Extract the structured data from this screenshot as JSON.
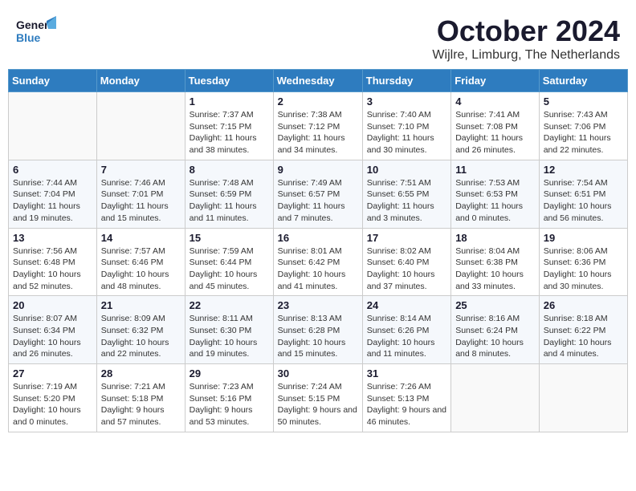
{
  "header": {
    "logo_general": "General",
    "logo_blue": "Blue",
    "title": "October 2024",
    "subtitle": "Wijlre, Limburg, The Netherlands"
  },
  "days_of_week": [
    "Sunday",
    "Monday",
    "Tuesday",
    "Wednesday",
    "Thursday",
    "Friday",
    "Saturday"
  ],
  "weeks": [
    [
      {
        "day": "",
        "info": ""
      },
      {
        "day": "",
        "info": ""
      },
      {
        "day": "1",
        "info": "Sunrise: 7:37 AM\nSunset: 7:15 PM\nDaylight: 11 hours and 38 minutes."
      },
      {
        "day": "2",
        "info": "Sunrise: 7:38 AM\nSunset: 7:12 PM\nDaylight: 11 hours and 34 minutes."
      },
      {
        "day": "3",
        "info": "Sunrise: 7:40 AM\nSunset: 7:10 PM\nDaylight: 11 hours and 30 minutes."
      },
      {
        "day": "4",
        "info": "Sunrise: 7:41 AM\nSunset: 7:08 PM\nDaylight: 11 hours and 26 minutes."
      },
      {
        "day": "5",
        "info": "Sunrise: 7:43 AM\nSunset: 7:06 PM\nDaylight: 11 hours and 22 minutes."
      }
    ],
    [
      {
        "day": "6",
        "info": "Sunrise: 7:44 AM\nSunset: 7:04 PM\nDaylight: 11 hours and 19 minutes."
      },
      {
        "day": "7",
        "info": "Sunrise: 7:46 AM\nSunset: 7:01 PM\nDaylight: 11 hours and 15 minutes."
      },
      {
        "day": "8",
        "info": "Sunrise: 7:48 AM\nSunset: 6:59 PM\nDaylight: 11 hours and 11 minutes."
      },
      {
        "day": "9",
        "info": "Sunrise: 7:49 AM\nSunset: 6:57 PM\nDaylight: 11 hours and 7 minutes."
      },
      {
        "day": "10",
        "info": "Sunrise: 7:51 AM\nSunset: 6:55 PM\nDaylight: 11 hours and 3 minutes."
      },
      {
        "day": "11",
        "info": "Sunrise: 7:53 AM\nSunset: 6:53 PM\nDaylight: 11 hours and 0 minutes."
      },
      {
        "day": "12",
        "info": "Sunrise: 7:54 AM\nSunset: 6:51 PM\nDaylight: 10 hours and 56 minutes."
      }
    ],
    [
      {
        "day": "13",
        "info": "Sunrise: 7:56 AM\nSunset: 6:48 PM\nDaylight: 10 hours and 52 minutes."
      },
      {
        "day": "14",
        "info": "Sunrise: 7:57 AM\nSunset: 6:46 PM\nDaylight: 10 hours and 48 minutes."
      },
      {
        "day": "15",
        "info": "Sunrise: 7:59 AM\nSunset: 6:44 PM\nDaylight: 10 hours and 45 minutes."
      },
      {
        "day": "16",
        "info": "Sunrise: 8:01 AM\nSunset: 6:42 PM\nDaylight: 10 hours and 41 minutes."
      },
      {
        "day": "17",
        "info": "Sunrise: 8:02 AM\nSunset: 6:40 PM\nDaylight: 10 hours and 37 minutes."
      },
      {
        "day": "18",
        "info": "Sunrise: 8:04 AM\nSunset: 6:38 PM\nDaylight: 10 hours and 33 minutes."
      },
      {
        "day": "19",
        "info": "Sunrise: 8:06 AM\nSunset: 6:36 PM\nDaylight: 10 hours and 30 minutes."
      }
    ],
    [
      {
        "day": "20",
        "info": "Sunrise: 8:07 AM\nSunset: 6:34 PM\nDaylight: 10 hours and 26 minutes."
      },
      {
        "day": "21",
        "info": "Sunrise: 8:09 AM\nSunset: 6:32 PM\nDaylight: 10 hours and 22 minutes."
      },
      {
        "day": "22",
        "info": "Sunrise: 8:11 AM\nSunset: 6:30 PM\nDaylight: 10 hours and 19 minutes."
      },
      {
        "day": "23",
        "info": "Sunrise: 8:13 AM\nSunset: 6:28 PM\nDaylight: 10 hours and 15 minutes."
      },
      {
        "day": "24",
        "info": "Sunrise: 8:14 AM\nSunset: 6:26 PM\nDaylight: 10 hours and 11 minutes."
      },
      {
        "day": "25",
        "info": "Sunrise: 8:16 AM\nSunset: 6:24 PM\nDaylight: 10 hours and 8 minutes."
      },
      {
        "day": "26",
        "info": "Sunrise: 8:18 AM\nSunset: 6:22 PM\nDaylight: 10 hours and 4 minutes."
      }
    ],
    [
      {
        "day": "27",
        "info": "Sunrise: 7:19 AM\nSunset: 5:20 PM\nDaylight: 10 hours and 0 minutes."
      },
      {
        "day": "28",
        "info": "Sunrise: 7:21 AM\nSunset: 5:18 PM\nDaylight: 9 hours and 57 minutes."
      },
      {
        "day": "29",
        "info": "Sunrise: 7:23 AM\nSunset: 5:16 PM\nDaylight: 9 hours and 53 minutes."
      },
      {
        "day": "30",
        "info": "Sunrise: 7:24 AM\nSunset: 5:15 PM\nDaylight: 9 hours and 50 minutes."
      },
      {
        "day": "31",
        "info": "Sunrise: 7:26 AM\nSunset: 5:13 PM\nDaylight: 9 hours and 46 minutes."
      },
      {
        "day": "",
        "info": ""
      },
      {
        "day": "",
        "info": ""
      }
    ]
  ]
}
